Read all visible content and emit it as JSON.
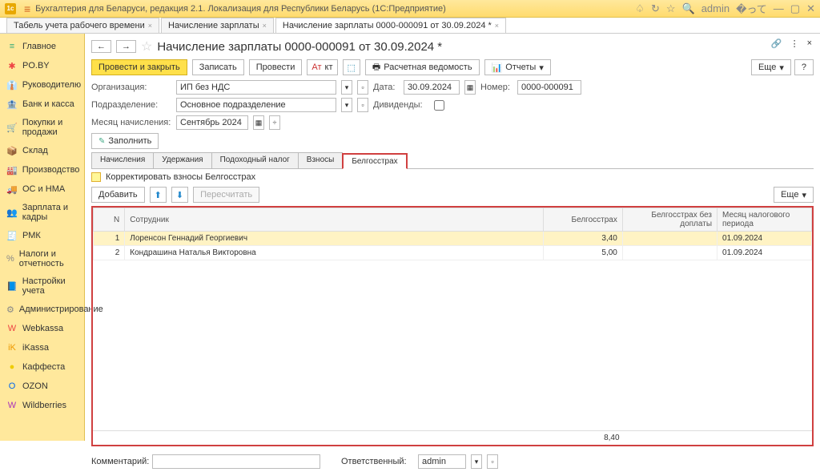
{
  "titlebar": {
    "logo": "1c",
    "title": "Бухгалтерия для Беларуси, редакция 2.1. Локализация для Республики Беларусь   (1С:Предприятие)",
    "user": "admin"
  },
  "maintabs": [
    {
      "label": "Табель учета рабочего времени"
    },
    {
      "label": "Начисление зарплаты"
    },
    {
      "label": "Начисление зарплаты 0000-000091 от 30.09.2024 *"
    }
  ],
  "sidebar": [
    {
      "icon": "≡",
      "label": "Главное",
      "c": "#3a7"
    },
    {
      "icon": "✱",
      "label": "PO.BY",
      "c": "#e44"
    },
    {
      "icon": "👔",
      "label": "Руководителю",
      "c": "#a66"
    },
    {
      "icon": "🏦",
      "label": "Банк и касса",
      "c": "#888"
    },
    {
      "icon": "🛒",
      "label": "Покупки и продажи",
      "c": "#888"
    },
    {
      "icon": "📦",
      "label": "Склад",
      "c": "#a55"
    },
    {
      "icon": "🏭",
      "label": "Производство",
      "c": "#888"
    },
    {
      "icon": "🚚",
      "label": "ОС и НМА",
      "c": "#888"
    },
    {
      "icon": "👥",
      "label": "Зарплата и кадры",
      "c": "#a55"
    },
    {
      "icon": "🧾",
      "label": "РМК",
      "c": "#a55"
    },
    {
      "icon": "%",
      "label": "Налоги и отчетность",
      "c": "#888"
    },
    {
      "icon": "📘",
      "label": "Настройки учета",
      "c": "#888"
    },
    {
      "icon": "⚙",
      "label": "Администрирование",
      "c": "#888"
    },
    {
      "icon": "W",
      "label": "Webkassa",
      "c": "#e44"
    },
    {
      "icon": "iK",
      "label": "iKassa",
      "c": "#e90"
    },
    {
      "icon": "●",
      "label": "Каффеста",
      "c": "#ec0"
    },
    {
      "icon": "O",
      "label": "OZON",
      "c": "#06e"
    },
    {
      "icon": "W",
      "label": "Wildberries",
      "c": "#a3b"
    }
  ],
  "doc": {
    "title": "Начисление зарплаты 0000-000091 от 30.09.2024 *",
    "btn_post_close": "Провести и закрыть",
    "btn_save": "Записать",
    "btn_post": "Провести",
    "btn_payslip": "Расчетная ведомость",
    "btn_reports": "Отчеты",
    "btn_more": "Еще",
    "org_label": "Организация:",
    "org_value": "ИП без НДС",
    "date_label": "Дата:",
    "date_value": "30.09.2024",
    "num_label": "Номер:",
    "num_value": "0000-000091",
    "dept_label": "Подразделение:",
    "dept_value": "Основное подразделение",
    "div_label": "Дивиденды:",
    "month_label": "Месяц начисления:",
    "month_value": "Сентябрь 2024",
    "btn_fill": "Заполнить"
  },
  "tabs": [
    "Начисления",
    "Удержания",
    "Подоходный налог",
    "Взносы",
    "Белгосстрах"
  ],
  "subbar": {
    "adjust_label": "Корректировать взносы Белгосстрах",
    "btn_add": "Добавить",
    "btn_recalc": "Пересчитать",
    "btn_more": "Еще"
  },
  "table": {
    "cols": [
      "N",
      "Сотрудник",
      "Белгосстрах",
      "Белгосстрах без доплаты",
      "Месяц налогового периода"
    ],
    "rows": [
      {
        "n": "1",
        "emp": "Лоренсон Геннадий Георгиевич",
        "b": "3,40",
        "bd": "",
        "m": "01.09.2024"
      },
      {
        "n": "2",
        "emp": "Кондрашина Наталья Викторовна",
        "b": "5,00",
        "bd": "",
        "m": "01.09.2024"
      }
    ],
    "total": "8,40"
  },
  "bottom": {
    "comment_label": "Комментарий:",
    "resp_label": "Ответственный:",
    "resp_value": "admin"
  }
}
